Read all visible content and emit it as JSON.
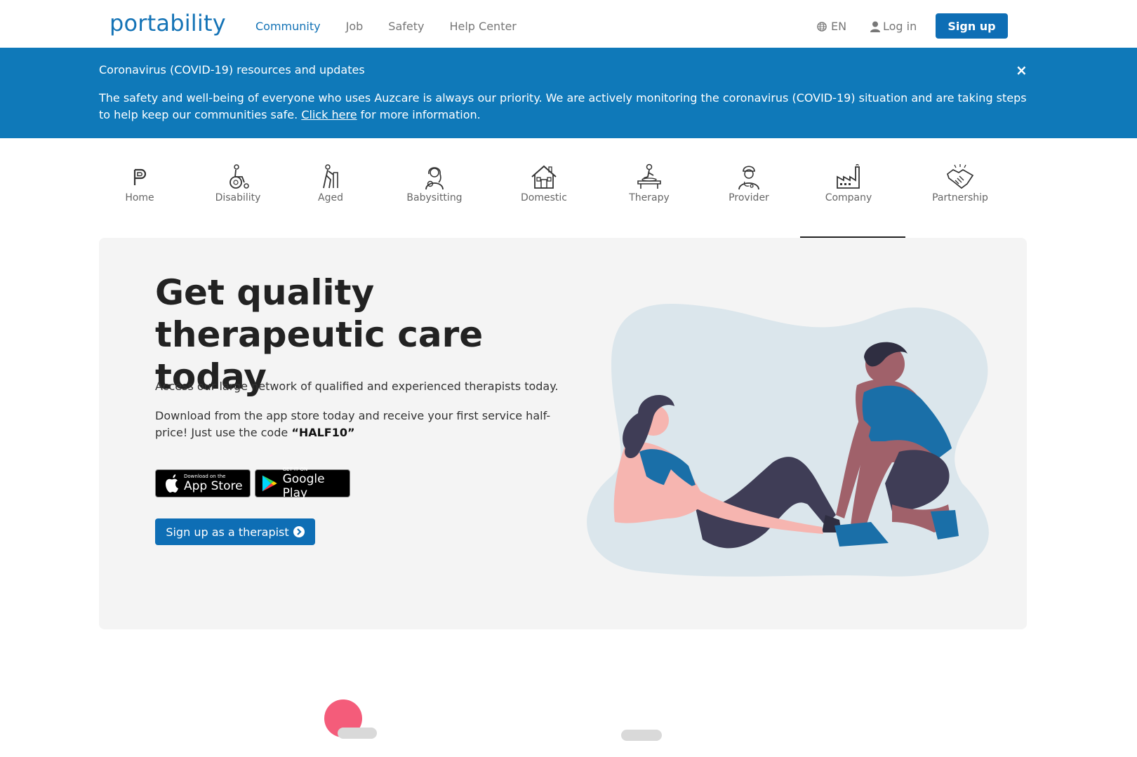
{
  "header": {
    "logo": "portability",
    "nav": [
      "Community",
      "Job",
      "Safety",
      "Help Center"
    ],
    "active_nav": "Community",
    "lang": "EN",
    "login": "Log in",
    "signup": "Sign up"
  },
  "banner": {
    "title": "Coronavirus (COVID-19) resources and updates",
    "text_before": "The safety and well-being of everyone who uses Auzcare is always our priority. We are actively monitoring the coronavirus (COVID-19) situation and are taking steps to help keep our communities safe.",
    "link": "Click here",
    "text_after": "for more information.",
    "close": "×"
  },
  "categories": [
    {
      "label": "Home",
      "icon": "portability-p-icon"
    },
    {
      "label": "Disability",
      "icon": "wheelchair-icon"
    },
    {
      "label": "Aged",
      "icon": "elderly-walker-icon"
    },
    {
      "label": "Babysitting",
      "icon": "babysitter-icon"
    },
    {
      "label": "Domestic",
      "icon": "house-icon"
    },
    {
      "label": "Therapy",
      "icon": "massage-table-icon"
    },
    {
      "label": "Provider",
      "icon": "doctor-icon"
    },
    {
      "label": "Company",
      "icon": "factory-icon"
    },
    {
      "label": "Partnership",
      "icon": "handshake-icon"
    }
  ],
  "active_category": "Company",
  "hero": {
    "title_line1": "Get quality",
    "title_line2": "therapeutic care today",
    "p1": "Access our large network of qualified and experienced therapists today.",
    "p2": "Download from the app store today and receive your first service half-price! Just use the code",
    "code": "“HALF10”",
    "appstore_small": "Download on the",
    "appstore_big": "App Store",
    "googleplay_small": "GET IT ON",
    "googleplay_big": "Google Play",
    "cta": "Sign up as a therapist"
  },
  "colors": {
    "brand": "#0e6eb5",
    "banner": "#0f79b9",
    "hero_bg": "#f4f4f4",
    "accent_red": "#f45c7a"
  }
}
